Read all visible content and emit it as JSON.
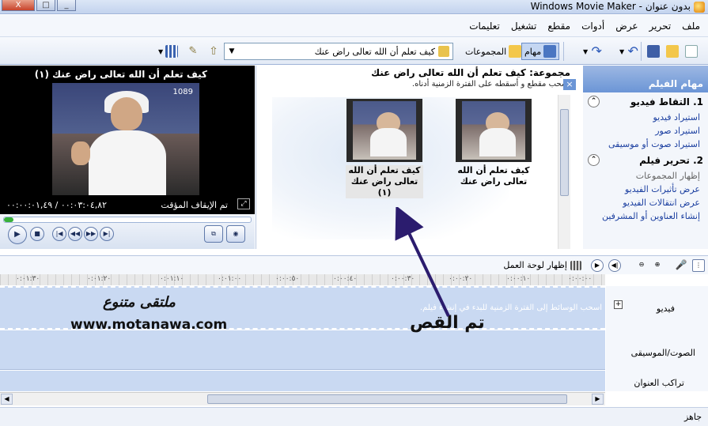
{
  "window": {
    "title": "Windows Movie Maker - بدون عنوان",
    "close": "X",
    "maximize": "□",
    "minimize": "_"
  },
  "menu": [
    "ملف",
    "تحرير",
    "عرض",
    "أدوات",
    "مقطع",
    "تشغيل",
    "تعليمات"
  ],
  "toolbar": {
    "tasks_label": "مهام",
    "collections_label": "المجموعات",
    "collection_selected": "كيف تعلم أن الله تعالى راض عنك"
  },
  "tasks": {
    "header": "مهام الفيلم",
    "sections": [
      {
        "title": "1. التقاط فيديو",
        "items": [
          "استيراد فيديو",
          "استيراد صور",
          "استيراد صوت أو موسيقى"
        ]
      },
      {
        "title": "2. تحرير فيلم",
        "items": [
          "إظهار المجموعات",
          "عرض تأثيرات الفيديو",
          "عرض انتقالات الفيديو",
          "إنشاء العناوين أو المشرفين"
        ]
      }
    ]
  },
  "collection": {
    "title": "مجموعة: كيف تعلم أن الله تعالى راض عنك",
    "hint": "اسحب مقطع و أسقطه على الفترة الزمنية أدناه.",
    "clips": [
      {
        "caption": "كيف تعلم أن الله تعالى راض عنك"
      },
      {
        "caption": "كيف تعلم أن الله تعالى راض عنك (١)"
      }
    ]
  },
  "preview": {
    "title": "كيف تعلم أن الله تعالى راض عنك (١)",
    "channel_logo": "1089",
    "state": "تم الإيقاف المؤقت",
    "time": "٠٠:٠٣:٠٤,٨٢ / ٠٠:٠٠:٠١,٤٩",
    "progress": 0.04
  },
  "timeline": {
    "show_storyboard": "إظهار لوحة العمل",
    "ticks": [
      "٠:٠٠:٠٠",
      "٠:٠٠:١٠",
      "٠:٠٠:٢٠",
      "٠:٠٠:٣٠",
      "٠:٠٠:٤٠",
      "٠:٠٠:٥٠",
      "٠:٠١:٠٠",
      "٠:٠١:١٠",
      "٠:٠١:٢٠",
      "٠:٠١:٣٠"
    ],
    "drag_hint": "اسحب الوسائط إلى الفترة الزمنية للبدء في إنشاء فيلم.",
    "tracks": {
      "video": "فيديو",
      "audio": "الصوت/الموسيقى",
      "title_overlay": "تراكب العنوان"
    }
  },
  "overlay": {
    "forum_name": "ملتقى متنوع",
    "url": "www.motanawa.com",
    "annotation": "تم القص"
  },
  "status": "جاهز"
}
